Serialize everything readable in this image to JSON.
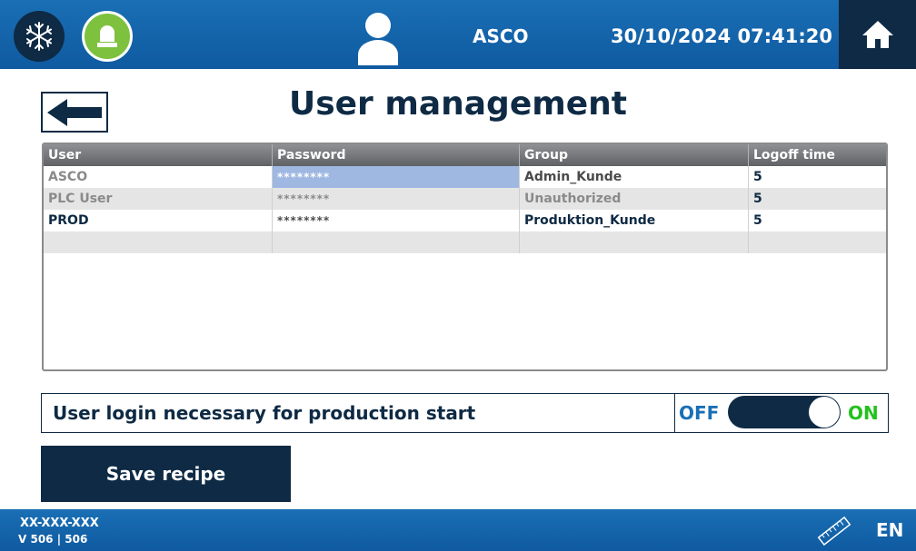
{
  "header": {
    "user": "ASCO",
    "datetime": "30/10/2024 07:41:20"
  },
  "page": {
    "title": "User management"
  },
  "table": {
    "columns": [
      "User",
      "Password",
      "Group",
      "Logoff time"
    ],
    "rows": [
      {
        "user": "ASCO",
        "password": "********",
        "group": "Admin_Kunde",
        "logoff": "5"
      },
      {
        "user": "PLC User",
        "password": "********",
        "group": "Unauthorized",
        "logoff": "5"
      },
      {
        "user": "PROD",
        "password": "********",
        "group": "Produktion_Kunde",
        "logoff": "5"
      }
    ]
  },
  "login_option": {
    "label": "User login necessary for production start",
    "off_label": "OFF",
    "on_label": "ON",
    "state": "on"
  },
  "actions": {
    "save_label": "Save recipe"
  },
  "footer": {
    "code": "XX-XXX-XXX",
    "version": "V 506 | 506",
    "language": "EN"
  },
  "colors": {
    "header_blue": "#1a6fb5",
    "navy": "#0e2a44",
    "beacon_green": "#7ec13f",
    "on_green": "#22c21d",
    "selection_blue": "#9fb8e2"
  },
  "icons": {
    "left": [
      "snowflake-icon",
      "beacon-icon"
    ],
    "center": "user-icon",
    "right": "home-icon",
    "back": "arrow-left-icon",
    "footer": "ruler-icon"
  }
}
